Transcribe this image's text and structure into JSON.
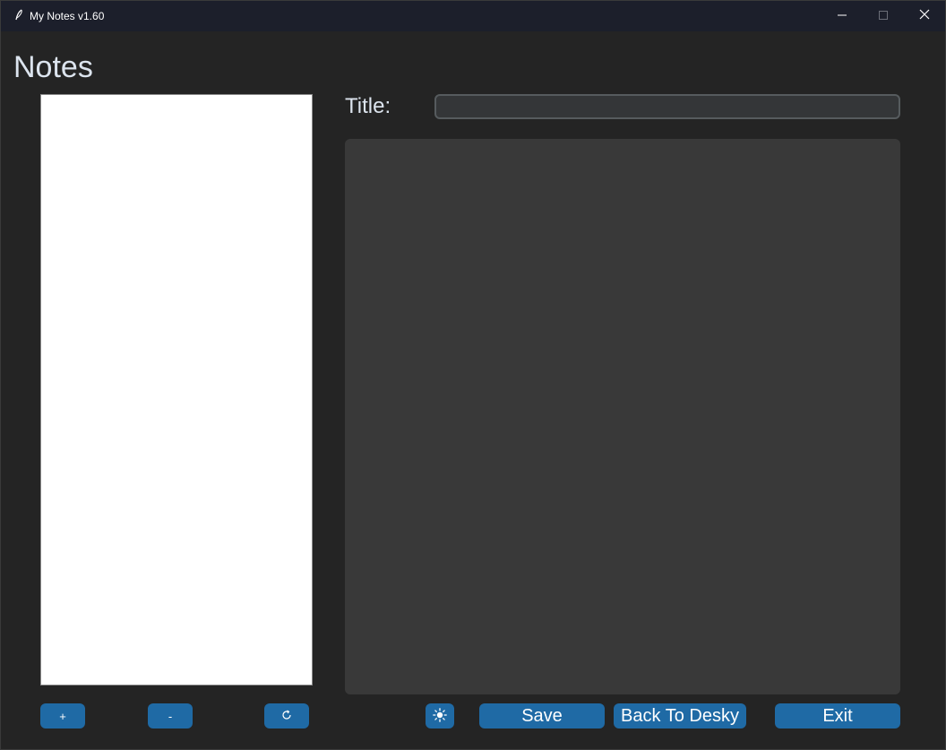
{
  "window": {
    "title": "My Notes v1.60",
    "icons": {
      "app": "feather-pen-icon",
      "minimize": "minimize-icon",
      "maximize": "maximize-icon",
      "close": "close-icon"
    }
  },
  "page": {
    "title": "Notes"
  },
  "editor": {
    "title_label": "Title:",
    "title_value": "",
    "body_value": ""
  },
  "notes_list": {
    "items": []
  },
  "list_buttons": {
    "add_label": "+",
    "remove_label": "-",
    "refresh_icon": "refresh-icon"
  },
  "actions": {
    "theme_icon": "sun-icon",
    "save_label": "Save",
    "back_label": "Back To Desky",
    "exit_label": "Exit"
  },
  "colors": {
    "background": "#242424",
    "titlebar": "#1c1f2b",
    "accent": "#1f6aa5",
    "text": "#dce4ee",
    "input_bg": "#343638",
    "textbox_bg": "#393939",
    "list_bg": "#ffffff"
  }
}
